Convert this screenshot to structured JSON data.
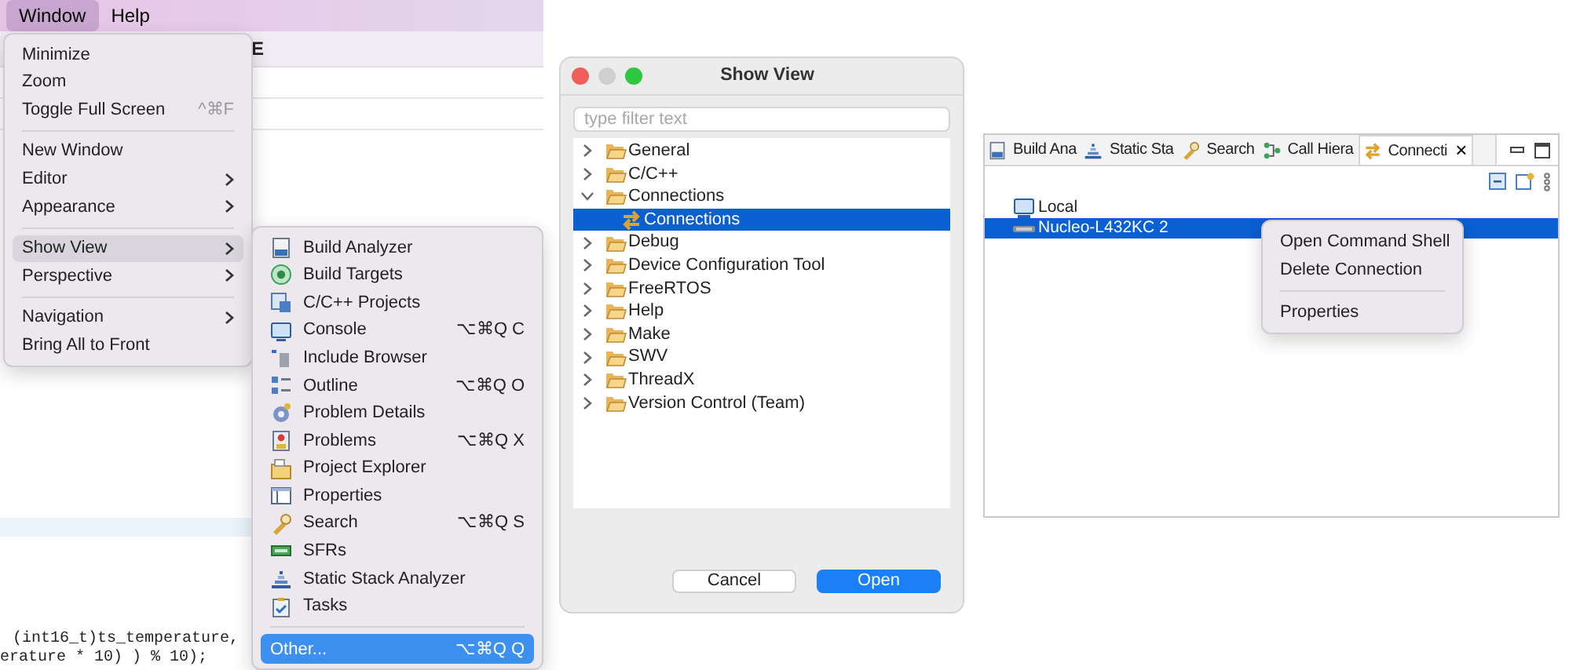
{
  "menubar": {
    "items": [
      {
        "label": "Window",
        "selected": true
      },
      {
        "label": "Help",
        "selected": false
      }
    ]
  },
  "editor": {
    "header": "E",
    "code_lines": [
      "(int16_t)ts_temperature,",
      "erature * 10) ) % 10);"
    ]
  },
  "window_menu": {
    "sections": [
      [
        {
          "label": "Minimize",
          "submenu": false,
          "selected": false
        },
        {
          "label": "Zoom",
          "submenu": false,
          "selected": false
        },
        {
          "label": "Toggle Full Screen",
          "shortcut": "^⌘F",
          "submenu": false,
          "selected": false
        }
      ],
      [
        {
          "label": "New Window",
          "submenu": false,
          "selected": false
        },
        {
          "label": "Editor",
          "submenu": true,
          "selected": false
        },
        {
          "label": "Appearance",
          "submenu": true,
          "selected": false
        }
      ],
      [
        {
          "label": "Show View",
          "submenu": true,
          "selected": true
        },
        {
          "label": "Perspective",
          "submenu": true,
          "selected": false
        }
      ],
      [
        {
          "label": "Navigation",
          "submenu": true,
          "selected": false
        },
        {
          "label": "Bring All to Front",
          "submenu": false,
          "selected": false
        }
      ]
    ]
  },
  "show_view_menu": {
    "items": [
      {
        "label": "Build Analyzer"
      },
      {
        "label": "Build Targets"
      },
      {
        "label": "C/C++ Projects"
      },
      {
        "label": "Console",
        "shortcut": "⌥⌘Q C"
      },
      {
        "label": "Include Browser"
      },
      {
        "label": "Outline",
        "shortcut": "⌥⌘Q O"
      },
      {
        "label": "Problem Details"
      },
      {
        "label": "Problems",
        "shortcut": "⌥⌘Q X"
      },
      {
        "label": "Project Explorer"
      },
      {
        "label": "Properties"
      },
      {
        "label": "Search",
        "shortcut": "⌥⌘Q S"
      },
      {
        "label": "SFRs"
      },
      {
        "label": "Static Stack Analyzer"
      },
      {
        "label": "Tasks"
      }
    ],
    "footer": {
      "label": "Other...",
      "shortcut": "⌥⌘Q Q",
      "selected": true
    }
  },
  "dialog": {
    "title": "Show View",
    "filter": {
      "placeholder": "type filter text"
    },
    "tree": [
      {
        "label": "General",
        "expanded": false,
        "selected": false
      },
      {
        "label": "C/C++",
        "expanded": false,
        "selected": false
      },
      {
        "label": "Connections",
        "expanded": true,
        "selected": false,
        "children": [
          {
            "label": "Connections",
            "selected": true
          }
        ]
      },
      {
        "label": "Debug",
        "expanded": false,
        "selected": false
      },
      {
        "label": "Device Configuration Tool",
        "expanded": false,
        "selected": false
      },
      {
        "label": "FreeRTOS",
        "expanded": false,
        "selected": false
      },
      {
        "label": "Help",
        "expanded": false,
        "selected": false
      },
      {
        "label": "Make",
        "expanded": false,
        "selected": false
      },
      {
        "label": "SWV",
        "expanded": false,
        "selected": false
      },
      {
        "label": "ThreadX",
        "expanded": false,
        "selected": false
      },
      {
        "label": "Version Control (Team)",
        "expanded": false,
        "selected": false
      }
    ],
    "buttons": [
      {
        "label": "Cancel",
        "default": false
      },
      {
        "label": "Open",
        "default": true
      }
    ]
  },
  "connections_view": {
    "tabs": [
      {
        "label": "Build Ana",
        "selected": false
      },
      {
        "label": "Static Sta",
        "selected": false
      },
      {
        "label": "Search",
        "selected": false
      },
      {
        "label": "Call Hiera",
        "selected": false
      },
      {
        "label": "Connecti",
        "selected": true,
        "close": "×"
      }
    ],
    "items": [
      {
        "label": "Local",
        "selected": false
      },
      {
        "label": "Nucleo-L432KC 2",
        "selected": true
      }
    ],
    "context_menu": {
      "sections": [
        [
          {
            "label": "Open Command Shell"
          },
          {
            "label": "Delete Connection"
          }
        ],
        [
          {
            "label": "Properties"
          }
        ]
      ]
    }
  }
}
